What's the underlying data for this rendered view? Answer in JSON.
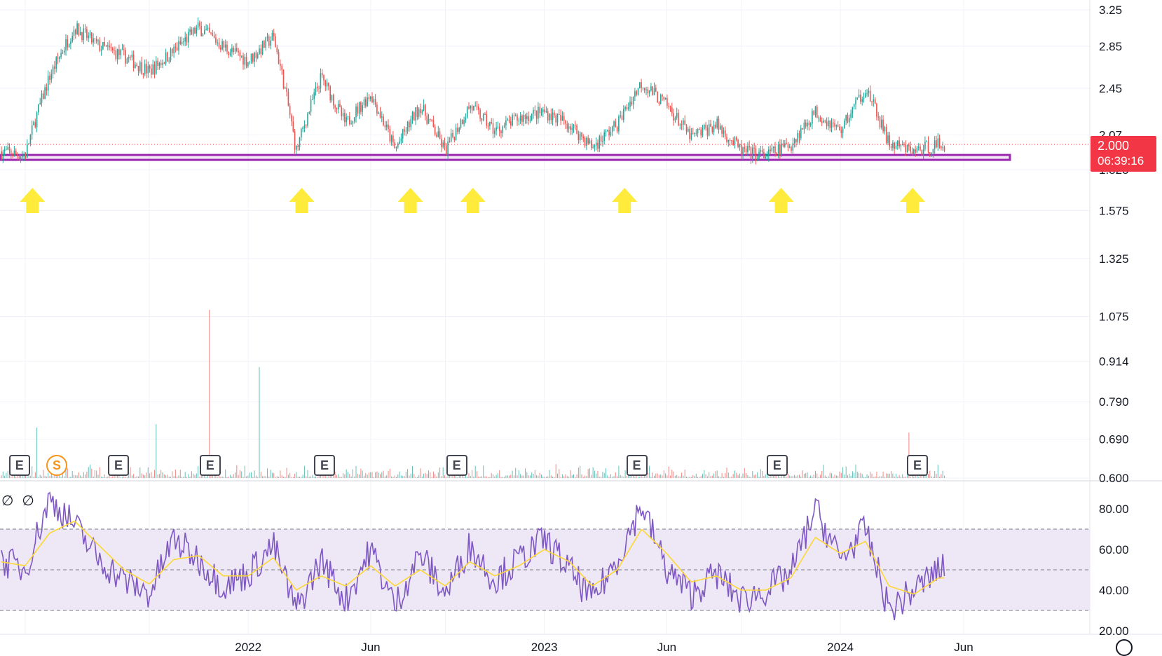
{
  "price_axis": {
    "labels": [
      "3.25",
      "2.85",
      "2.45",
      "2.07",
      "1.825",
      "1.575",
      "1.325",
      "1.075",
      "0.914",
      "0.790",
      "0.690",
      "0.600"
    ]
  },
  "rsi_axis": {
    "labels": [
      "80.00",
      "60.00",
      "40.00",
      "20.00"
    ],
    "icons": [
      "empty-set-icon",
      "empty-set-icon"
    ]
  },
  "time_axis": {
    "labels": [
      "2022",
      "Jun",
      "2023",
      "Jun",
      "2024",
      "Jun"
    ]
  },
  "last_price": {
    "value": "2.000",
    "countdown": "06:39:16",
    "color": "#f23645"
  },
  "events": [
    {
      "type": "earnings",
      "label": "E"
    },
    {
      "type": "split",
      "label": "S"
    },
    {
      "type": "earnings",
      "label": "E"
    },
    {
      "type": "earnings",
      "label": "E"
    },
    {
      "type": "earnings",
      "label": "E"
    },
    {
      "type": "earnings",
      "label": "E"
    },
    {
      "type": "earnings",
      "label": "E"
    },
    {
      "type": "earnings",
      "label": "E"
    },
    {
      "type": "earnings",
      "label": "E"
    }
  ],
  "colors": {
    "up": "#26a69a",
    "down": "#ef5350",
    "support_line": "#9c27b0",
    "arrow": "#ffeb3b",
    "rsi_line": "#7e57c2",
    "rsi_ma": "#fdd835",
    "rsi_band": "#ede7f6"
  },
  "chart_data": {
    "type": "candlestick",
    "scale": "log",
    "x_range": [
      "2021-03",
      "2024-06"
    ],
    "ylim": [
      0.6,
      3.3
    ],
    "price_path": {
      "x": [
        "2021-03-01",
        "2021-04-01",
        "2021-05-01",
        "2021-06-01",
        "2021-07-01",
        "2021-08-01",
        "2021-09-01",
        "2021-10-01",
        "2021-11-01",
        "2021-12-01",
        "2022-01-01",
        "2022-02-01",
        "2022-03-01",
        "2022-04-01",
        "2022-05-01",
        "2022-06-01",
        "2022-07-01",
        "2022-08-01",
        "2022-09-01",
        "2022-10-01",
        "2022-11-01",
        "2022-12-01",
        "2023-01-01",
        "2023-02-01",
        "2023-03-01",
        "2023-04-01",
        "2023-05-01",
        "2023-06-01",
        "2023-07-01",
        "2023-08-01",
        "2023-09-01",
        "2023-10-01",
        "2023-11-01",
        "2023-12-01",
        "2024-01-01",
        "2024-02-01",
        "2024-03-01",
        "2024-04-01",
        "2024-05-01"
      ],
      "close": [
        1.95,
        1.92,
        2.55,
        3.05,
        2.85,
        2.75,
        2.6,
        2.8,
        3.05,
        2.85,
        2.7,
        2.95,
        1.95,
        2.55,
        2.15,
        2.4,
        1.96,
        2.3,
        1.95,
        2.3,
        2.1,
        2.2,
        2.25,
        2.15,
        1.98,
        2.15,
        2.5,
        2.3,
        2.05,
        2.15,
        1.95,
        1.92,
        2.0,
        2.25,
        2.1,
        2.45,
        2.0,
        1.95,
        2.0
      ]
    },
    "volume": {
      "ylim_note": "volume pane shares price area bottom",
      "spikes": [
        {
          "x": "2021-04-15",
          "v": 0.3
        },
        {
          "x": "2021-09-10",
          "v": 0.32
        },
        {
          "x": "2021-11-15",
          "v": 1.0
        },
        {
          "x": "2022-01-15",
          "v": 0.66
        },
        {
          "x": "2024-03-25",
          "v": 0.27
        }
      ]
    },
    "support_zone": {
      "low": 1.9,
      "high": 1.925
    },
    "support_touches": [
      "2021-04-10",
      "2022-03-08",
      "2022-07-20",
      "2022-10-05",
      "2023-04-10",
      "2023-10-20",
      "2024-03-30"
    ],
    "rsi": {
      "ylim": [
        20,
        90
      ],
      "band": [
        30,
        70
      ],
      "midline": 50,
      "x": [
        "2021-03-01",
        "2021-04-01",
        "2021-05-01",
        "2021-06-01",
        "2021-07-01",
        "2021-08-01",
        "2021-09-01",
        "2021-10-01",
        "2021-11-01",
        "2021-12-01",
        "2022-01-01",
        "2022-02-01",
        "2022-03-01",
        "2022-04-01",
        "2022-05-01",
        "2022-06-01",
        "2022-07-01",
        "2022-08-01",
        "2022-09-01",
        "2022-10-01",
        "2022-11-01",
        "2022-12-01",
        "2023-01-01",
        "2023-02-01",
        "2023-03-01",
        "2023-04-01",
        "2023-05-01",
        "2023-06-01",
        "2023-07-01",
        "2023-08-01",
        "2023-09-01",
        "2023-10-01",
        "2023-11-01",
        "2023-12-01",
        "2024-01-01",
        "2024-02-01",
        "2024-03-01",
        "2024-04-01",
        "2024-05-01"
      ],
      "values": [
        55,
        50,
        85,
        72,
        55,
        45,
        38,
        65,
        55,
        42,
        48,
        62,
        30,
        55,
        35,
        60,
        32,
        58,
        38,
        62,
        45,
        55,
        65,
        50,
        35,
        55,
        82,
        50,
        38,
        48,
        35,
        40,
        48,
        80,
        55,
        70,
        30,
        40,
        50
      ],
      "ma": [
        54,
        52,
        68,
        74,
        62,
        50,
        43,
        55,
        57,
        47,
        47,
        56,
        40,
        47,
        42,
        52,
        42,
        50,
        42,
        54,
        47,
        52,
        60,
        54,
        42,
        50,
        70,
        58,
        44,
        47,
        40,
        40,
        46,
        66,
        58,
        64,
        42,
        38,
        46
      ]
    }
  }
}
